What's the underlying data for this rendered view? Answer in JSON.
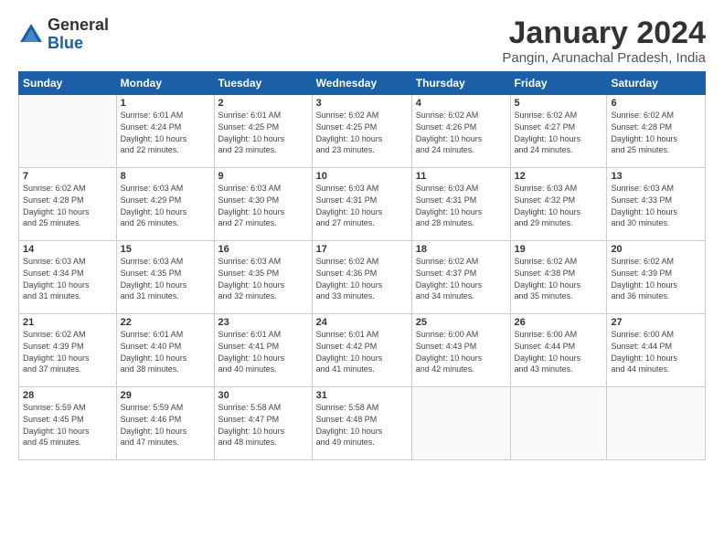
{
  "logo": {
    "general": "General",
    "blue": "Blue"
  },
  "title": "January 2024",
  "location": "Pangin, Arunachal Pradesh, India",
  "days_of_week": [
    "Sunday",
    "Monday",
    "Tuesday",
    "Wednesday",
    "Thursday",
    "Friday",
    "Saturday"
  ],
  "weeks": [
    [
      {
        "day": "",
        "info": ""
      },
      {
        "day": "1",
        "info": "Sunrise: 6:01 AM\nSunset: 4:24 PM\nDaylight: 10 hours\nand 22 minutes."
      },
      {
        "day": "2",
        "info": "Sunrise: 6:01 AM\nSunset: 4:25 PM\nDaylight: 10 hours\nand 23 minutes."
      },
      {
        "day": "3",
        "info": "Sunrise: 6:02 AM\nSunset: 4:25 PM\nDaylight: 10 hours\nand 23 minutes."
      },
      {
        "day": "4",
        "info": "Sunrise: 6:02 AM\nSunset: 4:26 PM\nDaylight: 10 hours\nand 24 minutes."
      },
      {
        "day": "5",
        "info": "Sunrise: 6:02 AM\nSunset: 4:27 PM\nDaylight: 10 hours\nand 24 minutes."
      },
      {
        "day": "6",
        "info": "Sunrise: 6:02 AM\nSunset: 4:28 PM\nDaylight: 10 hours\nand 25 minutes."
      }
    ],
    [
      {
        "day": "7",
        "info": "Sunrise: 6:02 AM\nSunset: 4:28 PM\nDaylight: 10 hours\nand 25 minutes."
      },
      {
        "day": "8",
        "info": "Sunrise: 6:03 AM\nSunset: 4:29 PM\nDaylight: 10 hours\nand 26 minutes."
      },
      {
        "day": "9",
        "info": "Sunrise: 6:03 AM\nSunset: 4:30 PM\nDaylight: 10 hours\nand 27 minutes."
      },
      {
        "day": "10",
        "info": "Sunrise: 6:03 AM\nSunset: 4:31 PM\nDaylight: 10 hours\nand 27 minutes."
      },
      {
        "day": "11",
        "info": "Sunrise: 6:03 AM\nSunset: 4:31 PM\nDaylight: 10 hours\nand 28 minutes."
      },
      {
        "day": "12",
        "info": "Sunrise: 6:03 AM\nSunset: 4:32 PM\nDaylight: 10 hours\nand 29 minutes."
      },
      {
        "day": "13",
        "info": "Sunrise: 6:03 AM\nSunset: 4:33 PM\nDaylight: 10 hours\nand 30 minutes."
      }
    ],
    [
      {
        "day": "14",
        "info": "Sunrise: 6:03 AM\nSunset: 4:34 PM\nDaylight: 10 hours\nand 31 minutes."
      },
      {
        "day": "15",
        "info": "Sunrise: 6:03 AM\nSunset: 4:35 PM\nDaylight: 10 hours\nand 31 minutes."
      },
      {
        "day": "16",
        "info": "Sunrise: 6:03 AM\nSunset: 4:35 PM\nDaylight: 10 hours\nand 32 minutes."
      },
      {
        "day": "17",
        "info": "Sunrise: 6:02 AM\nSunset: 4:36 PM\nDaylight: 10 hours\nand 33 minutes."
      },
      {
        "day": "18",
        "info": "Sunrise: 6:02 AM\nSunset: 4:37 PM\nDaylight: 10 hours\nand 34 minutes."
      },
      {
        "day": "19",
        "info": "Sunrise: 6:02 AM\nSunset: 4:38 PM\nDaylight: 10 hours\nand 35 minutes."
      },
      {
        "day": "20",
        "info": "Sunrise: 6:02 AM\nSunset: 4:39 PM\nDaylight: 10 hours\nand 36 minutes."
      }
    ],
    [
      {
        "day": "21",
        "info": "Sunrise: 6:02 AM\nSunset: 4:39 PM\nDaylight: 10 hours\nand 37 minutes."
      },
      {
        "day": "22",
        "info": "Sunrise: 6:01 AM\nSunset: 4:40 PM\nDaylight: 10 hours\nand 38 minutes."
      },
      {
        "day": "23",
        "info": "Sunrise: 6:01 AM\nSunset: 4:41 PM\nDaylight: 10 hours\nand 40 minutes."
      },
      {
        "day": "24",
        "info": "Sunrise: 6:01 AM\nSunset: 4:42 PM\nDaylight: 10 hours\nand 41 minutes."
      },
      {
        "day": "25",
        "info": "Sunrise: 6:00 AM\nSunset: 4:43 PM\nDaylight: 10 hours\nand 42 minutes."
      },
      {
        "day": "26",
        "info": "Sunrise: 6:00 AM\nSunset: 4:44 PM\nDaylight: 10 hours\nand 43 minutes."
      },
      {
        "day": "27",
        "info": "Sunrise: 6:00 AM\nSunset: 4:44 PM\nDaylight: 10 hours\nand 44 minutes."
      }
    ],
    [
      {
        "day": "28",
        "info": "Sunrise: 5:59 AM\nSunset: 4:45 PM\nDaylight: 10 hours\nand 45 minutes."
      },
      {
        "day": "29",
        "info": "Sunrise: 5:59 AM\nSunset: 4:46 PM\nDaylight: 10 hours\nand 47 minutes."
      },
      {
        "day": "30",
        "info": "Sunrise: 5:58 AM\nSunset: 4:47 PM\nDaylight: 10 hours\nand 48 minutes."
      },
      {
        "day": "31",
        "info": "Sunrise: 5:58 AM\nSunset: 4:48 PM\nDaylight: 10 hours\nand 49 minutes."
      },
      {
        "day": "",
        "info": ""
      },
      {
        "day": "",
        "info": ""
      },
      {
        "day": "",
        "info": ""
      }
    ]
  ]
}
